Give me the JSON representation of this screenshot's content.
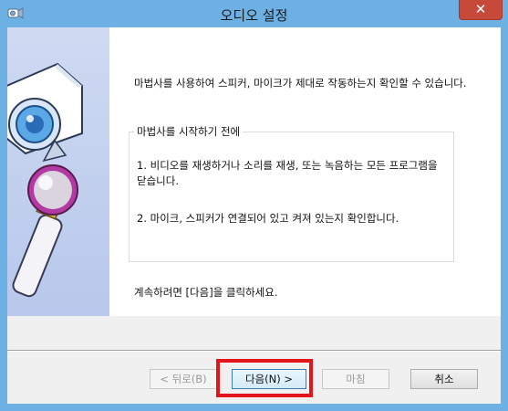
{
  "window": {
    "title": "오디오 설정",
    "close_label": "✕",
    "app_icon": "speaker-wizard-icon"
  },
  "side_panel": {
    "icons": [
      "webcam-icon",
      "microphone-icon"
    ]
  },
  "main": {
    "intro": "마법사를 사용하여 스피커, 마이크가 제대로 작동하는지 확인할 수 있습니다.",
    "group": {
      "legend": "마법사를 시작하기 전에",
      "step1": "1. 비디오를 재생하거나 소리를 재생, 또는 녹음하는 모든 프로그램을 닫습니다.",
      "step2": "2. 마이크, 스피커가 연결되어 있고 켜져 있는지 확인합니다."
    },
    "continue_text": "계속하려면 [다음]을 클릭하세요."
  },
  "buttons": {
    "back": "< 뒤로(B)",
    "next": "다음(N) >",
    "finish": "마침",
    "cancel": "취소"
  },
  "colors": {
    "titlebar": "#6cb0e4",
    "close": "#c7493a",
    "highlight": "#e3141a"
  }
}
